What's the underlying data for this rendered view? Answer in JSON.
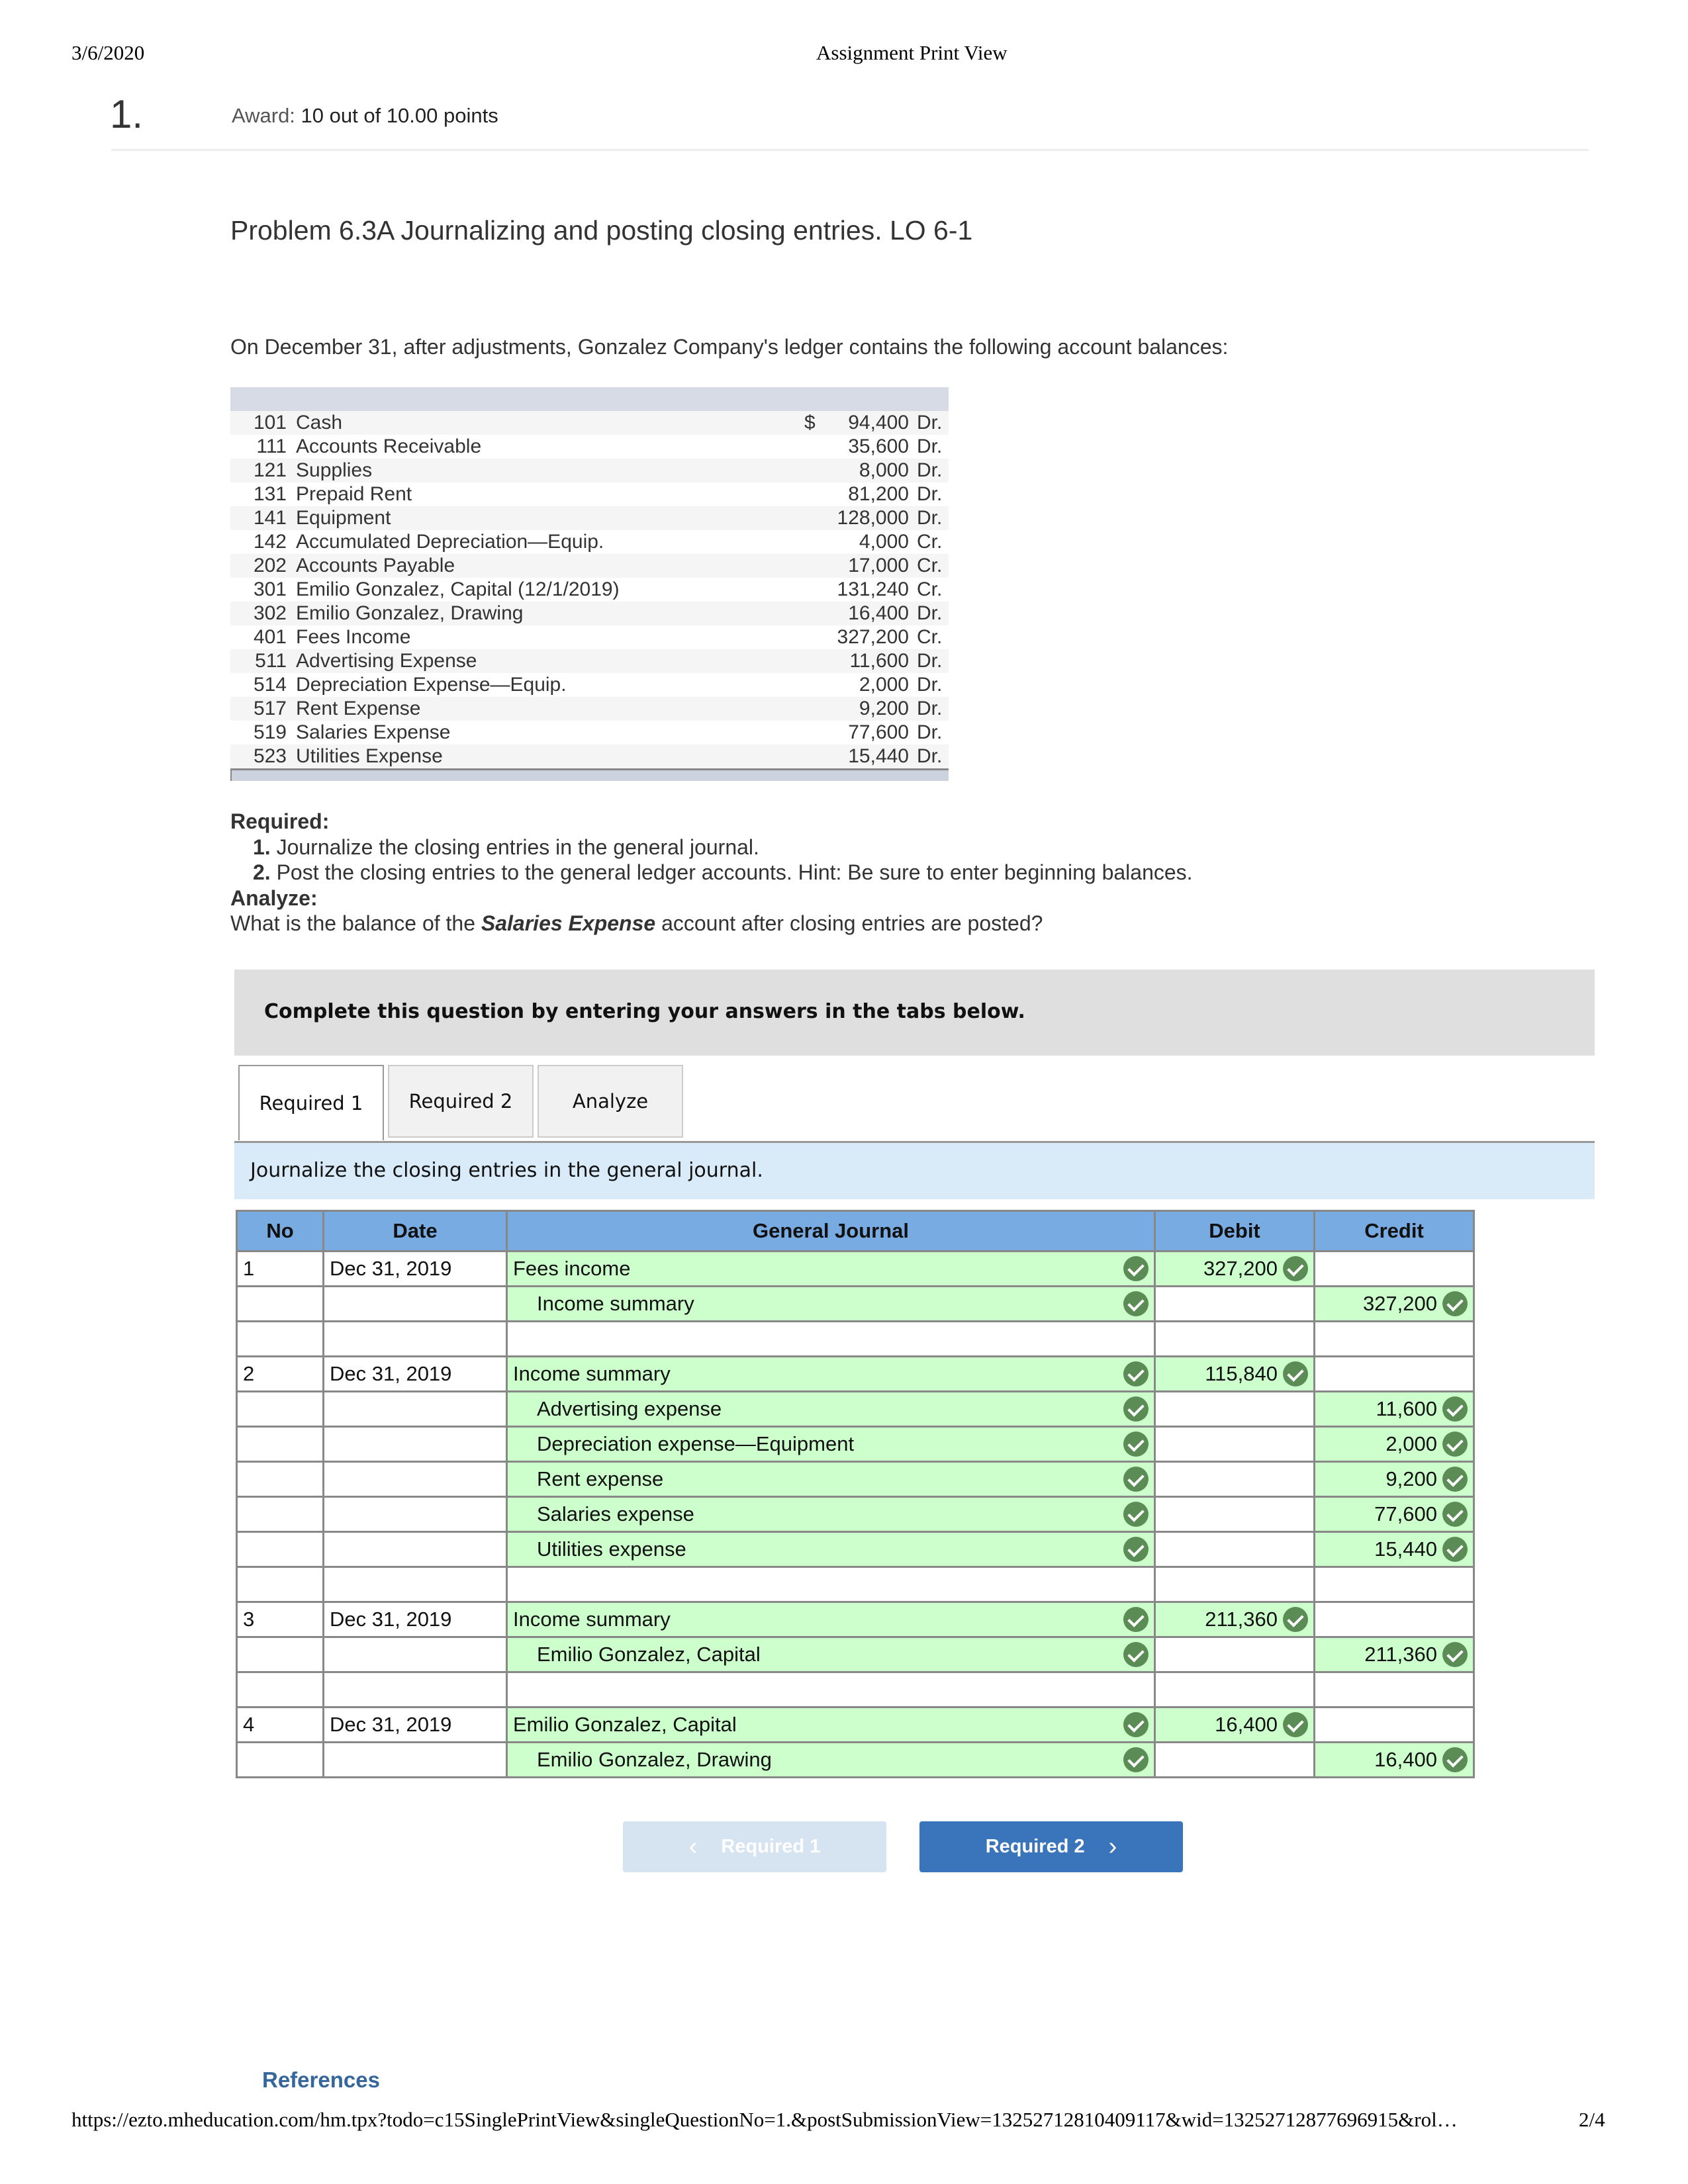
{
  "print_header": {
    "date": "3/6/2020",
    "title": "Assignment Print View"
  },
  "question": {
    "number": "1.",
    "award_label": "Award:",
    "award_value": "10 out of 10.00 points",
    "title": "Problem 6.3A Journalizing and posting closing entries. LO 6-1",
    "intro": "On December 31, after adjustments, Gonzalez Company's ledger contains the following account balances:"
  },
  "accounts": [
    {
      "no": "101",
      "name": "Cash",
      "currency": "$",
      "amount": "94,400",
      "side": "Dr."
    },
    {
      "no": "111",
      "name": "Accounts Receivable",
      "currency": "",
      "amount": "35,600",
      "side": "Dr."
    },
    {
      "no": "121",
      "name": "Supplies",
      "currency": "",
      "amount": "8,000",
      "side": "Dr."
    },
    {
      "no": "131",
      "name": "Prepaid Rent",
      "currency": "",
      "amount": "81,200",
      "side": "Dr."
    },
    {
      "no": "141",
      "name": "Equipment",
      "currency": "",
      "amount": "128,000",
      "side": "Dr."
    },
    {
      "no": "142",
      "name": "Accumulated Depreciation—Equip.",
      "currency": "",
      "amount": "4,000",
      "side": "Cr."
    },
    {
      "no": "202",
      "name": "Accounts Payable",
      "currency": "",
      "amount": "17,000",
      "side": "Cr."
    },
    {
      "no": "301",
      "name": "Emilio Gonzalez, Capital (12/1/2019)",
      "currency": "",
      "amount": "131,240",
      "side": "Cr."
    },
    {
      "no": "302",
      "name": "Emilio Gonzalez, Drawing",
      "currency": "",
      "amount": "16,400",
      "side": "Dr."
    },
    {
      "no": "401",
      "name": "Fees Income",
      "currency": "",
      "amount": "327,200",
      "side": "Cr."
    },
    {
      "no": "511",
      "name": "Advertising Expense",
      "currency": "",
      "amount": "11,600",
      "side": "Dr."
    },
    {
      "no": "514",
      "name": "Depreciation Expense—Equip.",
      "currency": "",
      "amount": "2,000",
      "side": "Dr."
    },
    {
      "no": "517",
      "name": "Rent Expense",
      "currency": "",
      "amount": "9,200",
      "side": "Dr."
    },
    {
      "no": "519",
      "name": "Salaries Expense",
      "currency": "",
      "amount": "77,600",
      "side": "Dr."
    },
    {
      "no": "523",
      "name": "Utilities Expense",
      "currency": "",
      "amount": "15,440",
      "side": "Dr."
    }
  ],
  "required": {
    "heading": "Required:",
    "items": [
      {
        "num": "1.",
        "text": "Journalize the closing entries in the general journal."
      },
      {
        "num": "2.",
        "text": "Post the closing entries to the general ledger accounts. Hint: Be sure to enter beginning balances."
      }
    ],
    "analyze_heading": "Analyze:",
    "analyze_pre": "What is the balance of the ",
    "analyze_emph": "Salaries Expense",
    "analyze_post": " account after closing entries are posted?"
  },
  "banner": "Complete this question by entering your answers in the tabs below.",
  "tabs": [
    {
      "label": "Required 1",
      "active": true
    },
    {
      "label": "Required 2",
      "active": false
    },
    {
      "label": "Analyze",
      "active": false
    }
  ],
  "tab_instruction": "Journalize the closing entries in the general journal.",
  "journal": {
    "headers": {
      "no": "No",
      "date": "Date",
      "account": "General Journal",
      "debit": "Debit",
      "credit": "Credit"
    },
    "rows": [
      {
        "no": "1",
        "date": "Dec 31, 2019",
        "account": "Fees income",
        "indent": false,
        "debit": "327,200",
        "credit": ""
      },
      {
        "no": "",
        "date": "",
        "account": "Income summary",
        "indent": true,
        "debit": "",
        "credit": "327,200"
      },
      {
        "no": "",
        "date": "",
        "account": "",
        "indent": false,
        "debit": "",
        "credit": ""
      },
      {
        "no": "2",
        "date": "Dec 31, 2019",
        "account": "Income summary",
        "indent": false,
        "debit": "115,840",
        "credit": ""
      },
      {
        "no": "",
        "date": "",
        "account": "Advertising expense",
        "indent": true,
        "debit": "",
        "credit": "11,600"
      },
      {
        "no": "",
        "date": "",
        "account": "Depreciation expense—Equipment",
        "indent": true,
        "debit": "",
        "credit": "2,000"
      },
      {
        "no": "",
        "date": "",
        "account": "Rent expense",
        "indent": true,
        "debit": "",
        "credit": "9,200"
      },
      {
        "no": "",
        "date": "",
        "account": "Salaries expense",
        "indent": true,
        "debit": "",
        "credit": "77,600"
      },
      {
        "no": "",
        "date": "",
        "account": "Utilities expense",
        "indent": true,
        "debit": "",
        "credit": "15,440"
      },
      {
        "no": "",
        "date": "",
        "account": "",
        "indent": false,
        "debit": "",
        "credit": ""
      },
      {
        "no": "3",
        "date": "Dec 31, 2019",
        "account": "Income summary",
        "indent": false,
        "debit": "211,360",
        "credit": ""
      },
      {
        "no": "",
        "date": "",
        "account": "Emilio Gonzalez, Capital",
        "indent": true,
        "debit": "",
        "credit": "211,360"
      },
      {
        "no": "",
        "date": "",
        "account": "",
        "indent": false,
        "debit": "",
        "credit": ""
      },
      {
        "no": "4",
        "date": "Dec 31, 2019",
        "account": "Emilio Gonzalez, Capital",
        "indent": false,
        "debit": "16,400",
        "credit": ""
      },
      {
        "no": "",
        "date": "",
        "account": "Emilio Gonzalez, Drawing",
        "indent": true,
        "debit": "",
        "credit": "16,400"
      }
    ]
  },
  "nav": {
    "prev_label": "Required 1",
    "next_label": "Required 2",
    "prev_enabled": false
  },
  "references_label": "References",
  "print_footer": {
    "url": "https://ezto.mheducation.com/hm.tpx?todo=c15SinglePrintView&singleQuestionNo=1.&postSubmissionView=13252712810409117&wid=13252712877696915&rol…",
    "page": "2/4"
  },
  "colors": {
    "correct_bg": "#ccffcc",
    "check_green": "#5c8c55",
    "header_blue": "#78abe2",
    "button_blue": "#3a74bb",
    "link_blue": "#36679c"
  }
}
